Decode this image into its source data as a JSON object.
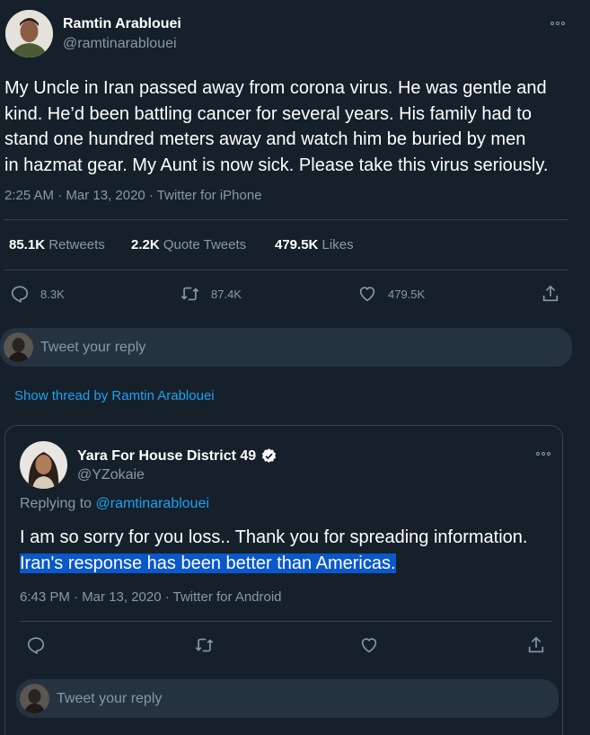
{
  "main_tweet": {
    "author_name": "Ramtin Arablouei",
    "handle": "@ramtinarablouei",
    "text_lines": [
      "My Uncle in Iran passed away from corona virus. He was gentle and",
      "kind. He’d been battling cancer for several years. His family had to",
      "stand one hundred meters away and watch him be buried by men",
      "in hazmat gear. My Aunt is now sick. Please take this virus seriously."
    ],
    "timestamp": "2:25 AM · Mar 13, 2020 · Twitter for iPhone",
    "stats": {
      "retweets_count": "85.1K",
      "retweets_label": "Retweets",
      "quote_count": "2.2K",
      "quote_label": "Quote Tweets",
      "likes_count": "479.5K",
      "likes_label": "Likes"
    },
    "actions": {
      "reply_count": "8.3K",
      "retweet_count": "87.4K",
      "like_count": "479.5K"
    }
  },
  "reply_box_1": {
    "placeholder": "Tweet your reply"
  },
  "show_thread": "Show thread by Ramtin Arablouei",
  "reply_tweet": {
    "author_name": "Yara For House District 49",
    "handle": "@YZokaie",
    "replying_to_label": "Replying to",
    "replying_to_handle": "@ramtinarablouei",
    "text_line1": "I am so sorry for you loss.. Thank you for spreading information.",
    "text_line2_highlighted": "Iran's response has been better than Americas.",
    "timestamp": "6:43 PM · Mar 13, 2020 · Twitter for Android"
  },
  "reply_box_2": {
    "placeholder": "Tweet your reply"
  },
  "colors": {
    "background": "#15202b",
    "accent": "#1da1f2",
    "muted": "#8899a6",
    "selection": "#0a58ca"
  }
}
